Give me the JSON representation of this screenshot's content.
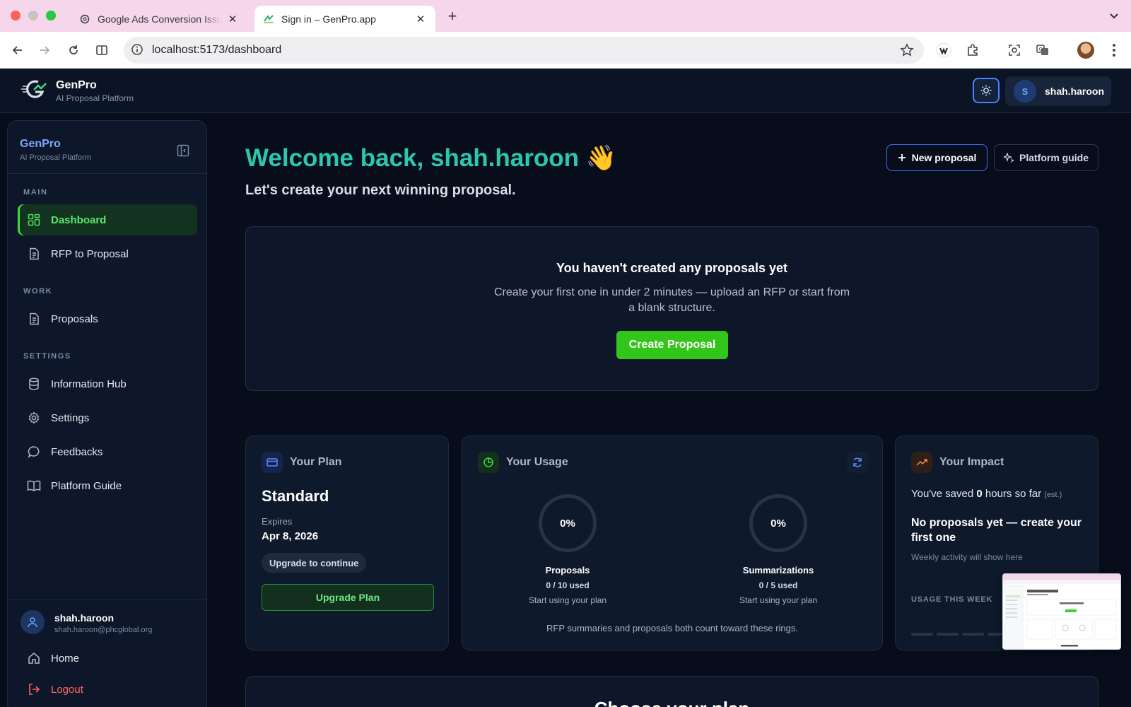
{
  "browser": {
    "tabs": [
      {
        "title": "Google Ads Conversion Issue"
      },
      {
        "title": "Sign in – GenPro.app"
      }
    ],
    "url": "localhost:5173/dashboard"
  },
  "header": {
    "brand": "GenPro",
    "brand_sub": "AI Proposal Platform",
    "user_initial": "S",
    "username": "shah.haroon"
  },
  "sidebar": {
    "brand": "GenPro",
    "brand_sub": "AI Proposal Platform",
    "sections": {
      "main": "MAIN",
      "work": "WORK",
      "settings": "SETTINGS"
    },
    "items": {
      "dashboard": "Dashboard",
      "rfp": "RFP to Proposal",
      "proposals": "Proposals",
      "info_hub": "Information Hub",
      "settings": "Settings",
      "feedbacks": "Feedbacks",
      "guide": "Platform Guide",
      "home": "Home",
      "logout": "Logout"
    },
    "user": {
      "name": "shah.haroon",
      "email": "shah.haroon@phcglobal.org"
    }
  },
  "main": {
    "welcome": "Welcome back, shah.haroon 👋",
    "subtitle": "Let's create your next winning proposal.",
    "new_proposal": "New proposal",
    "platform_guide": "Platform guide",
    "empty": {
      "title": "You haven't created any proposals yet",
      "desc": "Create your first one in under 2 minutes — upload an RFP or start from a blank structure.",
      "cta": "Create Proposal"
    },
    "plan": {
      "title": "Your Plan",
      "name": "Standard",
      "expires_label": "Expires",
      "expires_value": "Apr 8, 2026",
      "badge": "Upgrade to continue",
      "upgrade": "Upgrade Plan"
    },
    "usage": {
      "title": "Your Usage",
      "rings": [
        {
          "pct": "0%",
          "label": "Proposals",
          "used": "0 / 10 used",
          "sub": "Start using your plan"
        },
        {
          "pct": "0%",
          "label": "Summarizations",
          "used": "0 / 5 used",
          "sub": "Start using your plan"
        }
      ],
      "footnote": "RFP summaries and proposals both count toward these rings."
    },
    "impact": {
      "title": "Your Impact",
      "saved_pre": "You've saved ",
      "saved_num": "0",
      "saved_post": " hours so far ",
      "saved_est": "(est.)",
      "none": "No proposals yet — create your first one",
      "weekly": "Weekly activity will show here",
      "usage_week": "USAGE THIS WEEK"
    },
    "choose_plan": "Choose your plan"
  },
  "colors": {
    "accent_teal": "#2dc7ae",
    "accent_green": "#33c61a",
    "accent_blue": "#3b6cf5",
    "background": "#070d1a"
  }
}
